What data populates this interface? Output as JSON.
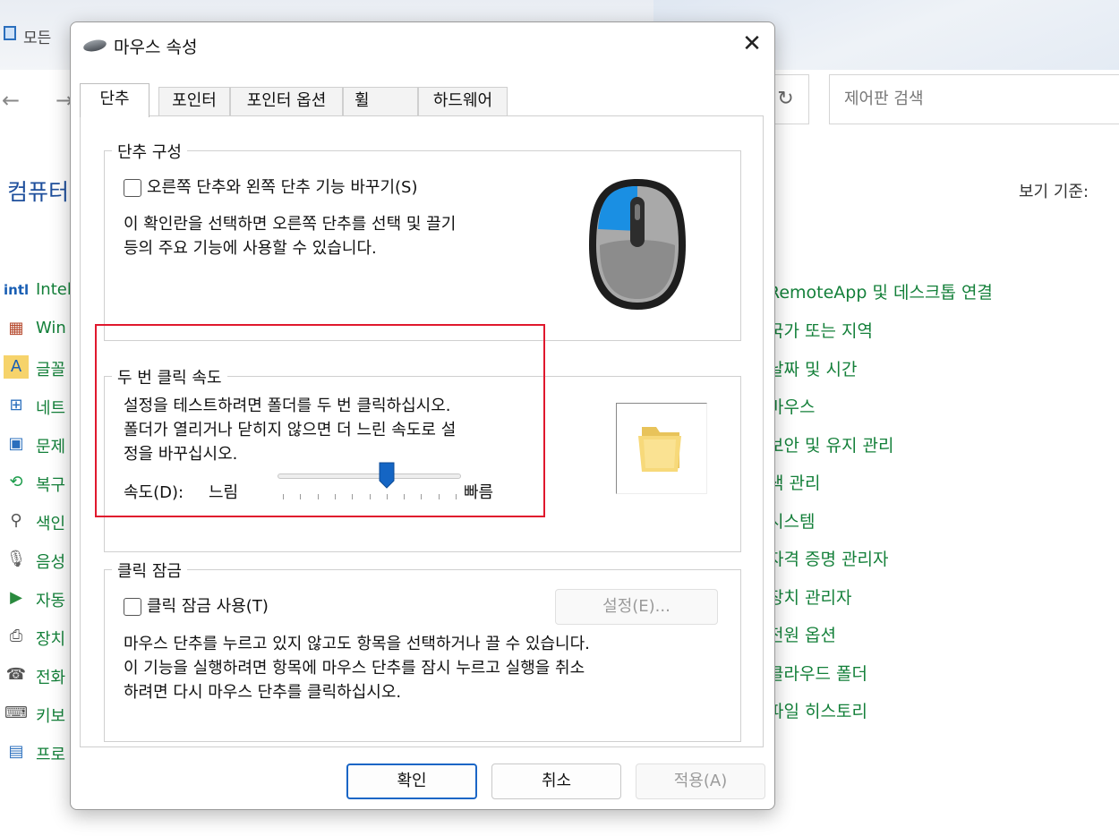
{
  "background_window": {
    "title": "모든 ",
    "search_placeholder": "제어판 검색",
    "heading": "컴퓨터",
    "view_by": "보기 기준:",
    "left_items": [
      {
        "label": "Intel",
        "icon": "intel-icon"
      },
      {
        "label": "Win",
        "icon": "firewall-icon"
      },
      {
        "label": "글꼴",
        "icon": "font-icon"
      },
      {
        "label": "네트",
        "icon": "network-icon"
      },
      {
        "label": "문제",
        "icon": "troubleshoot-icon"
      },
      {
        "label": "복구",
        "icon": "recovery-icon"
      },
      {
        "label": "색인",
        "icon": "indexing-icon"
      },
      {
        "label": "음성",
        "icon": "microphone-icon"
      },
      {
        "label": "자동",
        "icon": "autoplay-icon"
      },
      {
        "label": "장치",
        "icon": "devices-icon"
      },
      {
        "label": "전화",
        "icon": "phone-icon"
      },
      {
        "label": "키보",
        "icon": "keyboard-icon"
      },
      {
        "label": "프로",
        "icon": "programs-icon"
      }
    ],
    "right_items": [
      "RemoteApp 및 데스크톱 연결",
      "국가 또는 지역",
      "날짜 및 시간",
      "마우스",
      "보안 및 유지 관리",
      "색 관리",
      "시스템",
      "자격 증명 관리자",
      "장치 관리자",
      "전원 옵션",
      "클라우드 폴더",
      "파일 히스토리"
    ]
  },
  "dialog": {
    "title": "마우스 속성",
    "close_glyph": "✕",
    "tabs": [
      "단추",
      "포인터",
      "포인터 옵션",
      "휠",
      "하드웨어"
    ],
    "button_config": {
      "legend": "단추 구성",
      "switch_label": "오른쪽 단추와 왼쪽 단추 기능 바꾸기(S)",
      "desc_line1": "이 확인란을 선택하면 오른쪽 단추를 선택 및 끌기",
      "desc_line2": "등의 주요 기능에 사용할 수 있습니다."
    },
    "double_click": {
      "legend": "두 번 클릭 속도",
      "desc_line1": "설정을 테스트하려면 폴더를 두 번 클릭하십시오.",
      "desc_line2": "폴더가 열리거나 닫히지 않으면 더 느린 속도로 설",
      "desc_line3": "정을 바꾸십시오.",
      "speed_label": "속도(D):",
      "slow_label": "느림",
      "fast_label": "빠름",
      "slider_value": 0.6
    },
    "click_lock": {
      "legend": "클릭 잠금",
      "enable_label": "클릭 잠금 사용(T)",
      "settings_button": "설정(E)...",
      "desc_line1": "마우스 단추를 누르고 있지 않고도 항목을 선택하거나 끌 수 있습니다.",
      "desc_line2": "이 기능을 실행하려면 항목에 마우스 단추를 잠시 누르고 실행을 취소",
      "desc_line3": "하려면 다시 마우스 단추를 클릭하십시오."
    },
    "buttons": {
      "ok": "확인",
      "cancel": "취소",
      "apply": "적용(A)"
    }
  },
  "colors": {
    "link_green": "#14803a",
    "accent_blue": "#1a66c6",
    "highlight_red": "#e0182d"
  }
}
